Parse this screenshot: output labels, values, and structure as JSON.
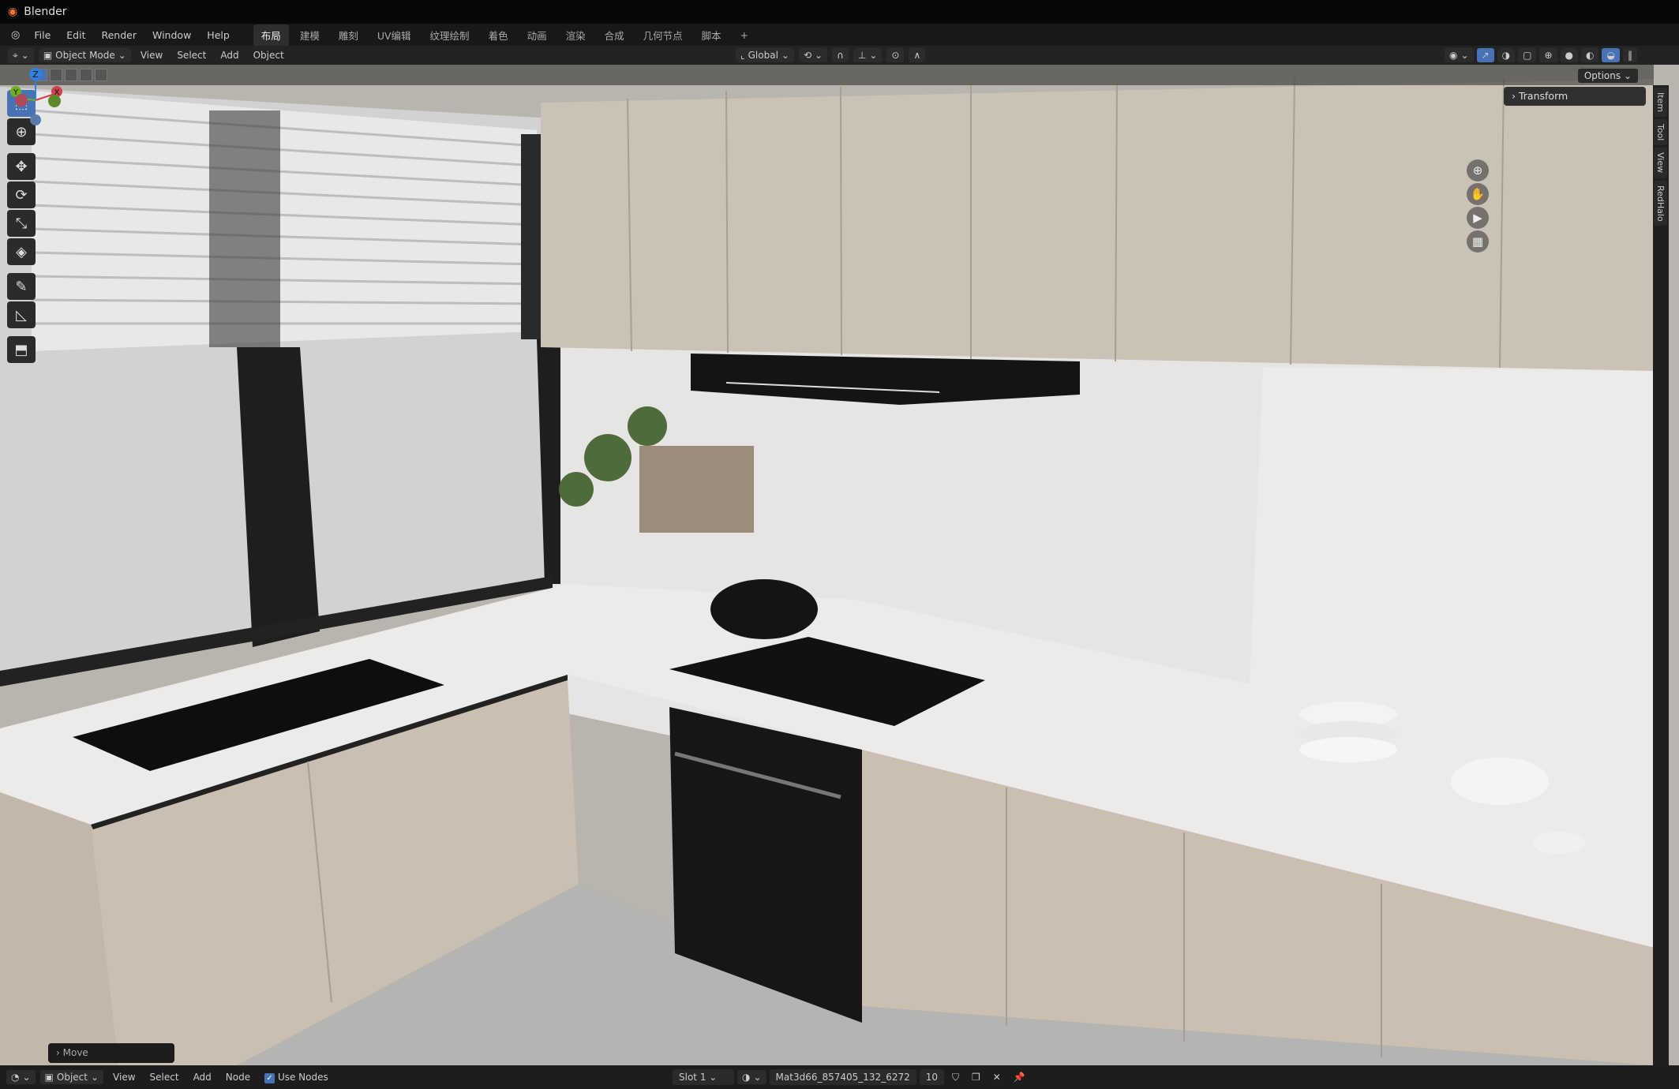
{
  "title": "Blender",
  "menu": [
    "File",
    "Edit",
    "Render",
    "Window",
    "Help"
  ],
  "workspaces": [
    "布局",
    "建模",
    "雕刻",
    "UV编辑",
    "纹理绘制",
    "着色",
    "动画",
    "渲染",
    "合成",
    "几何节点",
    "脚本"
  ],
  "add_workspace": "+",
  "header": {
    "mode": "Object Mode",
    "menus": [
      "View",
      "Select",
      "Add",
      "Object"
    ],
    "orientation": "Global"
  },
  "viewport": {
    "options": "Options",
    "transform": "Transform",
    "sidetabs": [
      "Item",
      "Tool",
      "View",
      "RedHalo"
    ],
    "last_op": "Move",
    "gizmo": {
      "x": "X",
      "y": "Y",
      "z": "Z"
    }
  },
  "bottom": {
    "mode": "Object",
    "menus": [
      "View",
      "Select",
      "Add",
      "Node"
    ],
    "use_nodes": "Use Nodes",
    "slot": "Slot 1",
    "material": "Mat3d66_857405_132_6272",
    "users": "10"
  },
  "colors": {
    "accent": "#4772b3"
  }
}
